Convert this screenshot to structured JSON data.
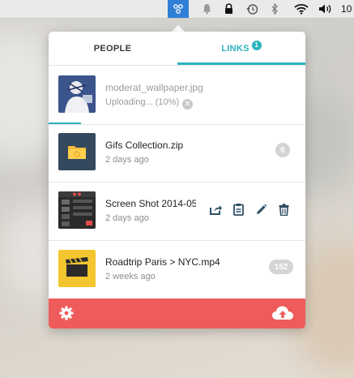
{
  "menubar": {
    "time": "10",
    "icons": [
      "app-icon",
      "bell-icon",
      "lock-icon",
      "history-icon",
      "bluetooth-icon",
      "wifi-icon",
      "volume-icon"
    ]
  },
  "tabs": {
    "people": "PEOPLE",
    "links": "LINKS",
    "links_badge": "1"
  },
  "uploads": [
    {
      "name": "moderat_wallpaper.jpg",
      "status": "Uploading... (10%)",
      "progress": 0.1
    },
    {
      "name": "Gifs Collection.zip",
      "date": "2 days ago",
      "count": "6"
    },
    {
      "name": "Screen Shot 2014-05",
      "date": "2 days ago"
    },
    {
      "name": "Roadtrip Paris > NYC.mp4",
      "date": "2 weeks ago",
      "count": "152"
    }
  ],
  "colors": {
    "accent": "#2bb3bd",
    "footer": "#ef5b5b",
    "menubar_app": "#2f7fd6"
  },
  "actions": [
    "share-icon",
    "clipboard-icon",
    "edit-icon",
    "trash-icon"
  ],
  "footer": {
    "icons": [
      "settings-gear-icon",
      "cloud-upload-icon"
    ]
  }
}
